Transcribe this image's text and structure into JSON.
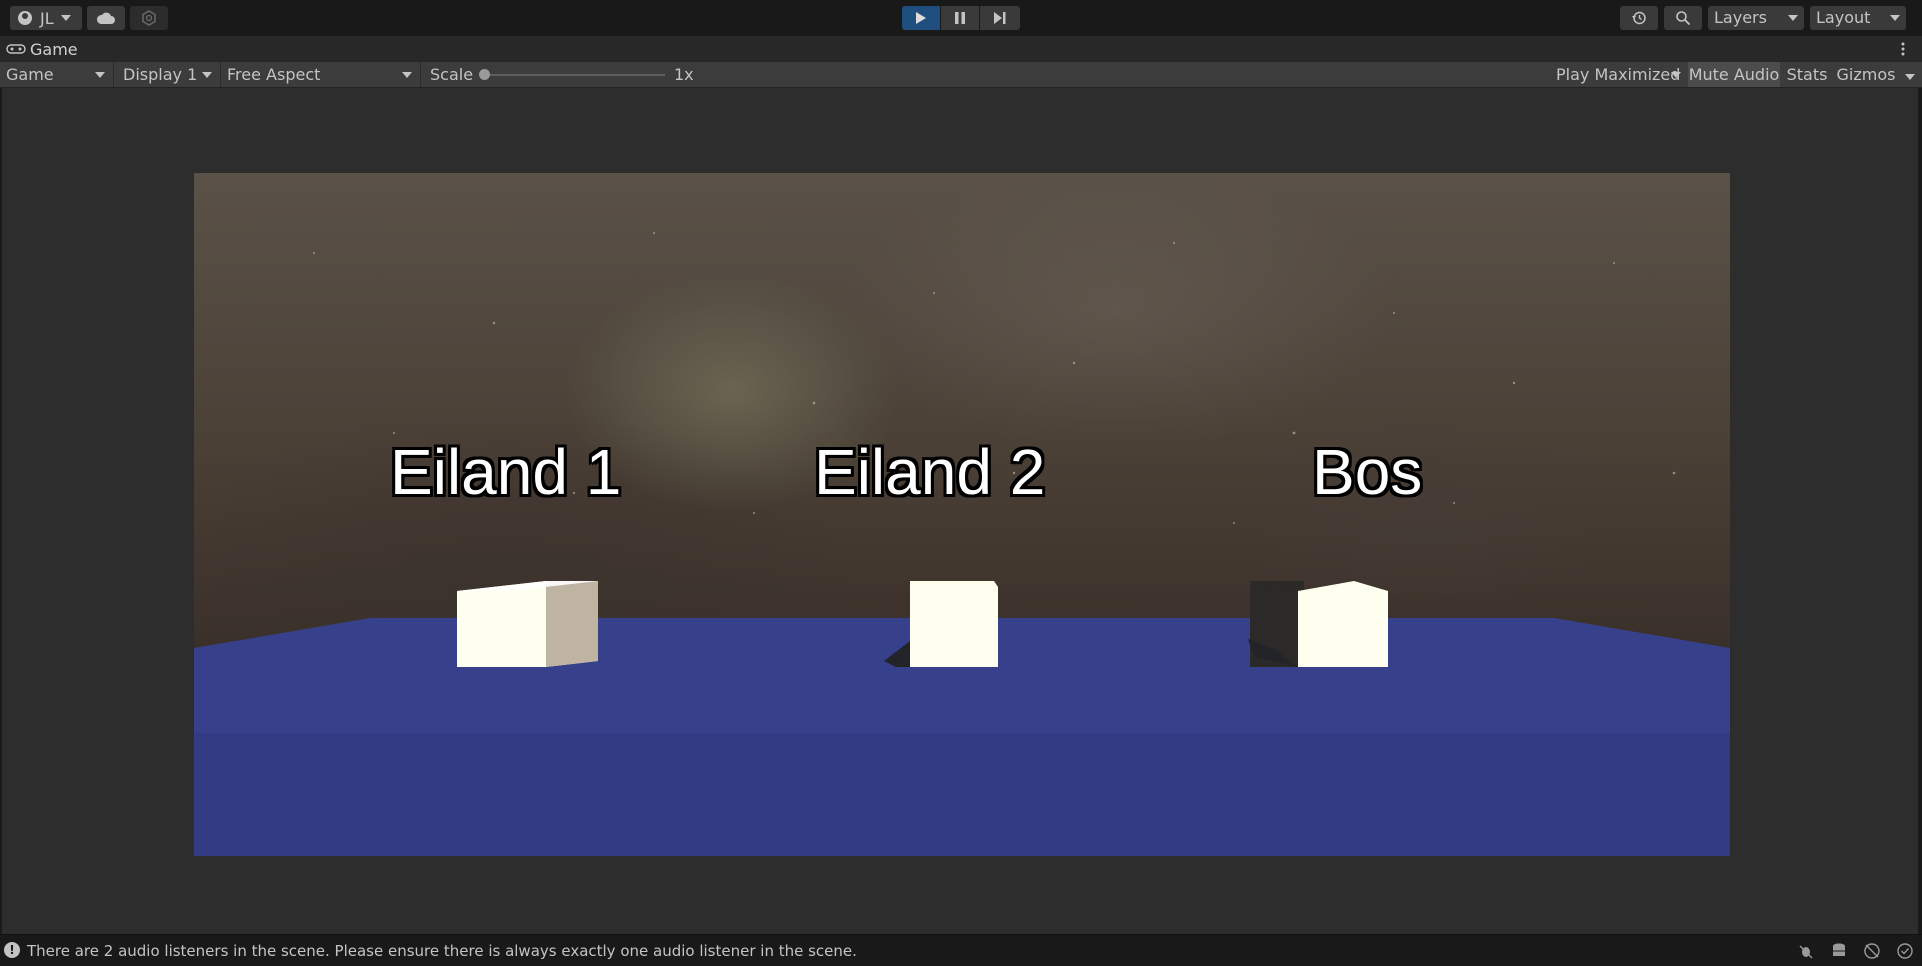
{
  "toolbar": {
    "account_label": "JL",
    "layers_label": "Layers",
    "layout_label": "Layout"
  },
  "tab": {
    "title": "Game"
  },
  "gamebar": {
    "mode": "Game",
    "display": "Display 1",
    "aspect": "Free Aspect",
    "scale_label": "Scale",
    "scale_value": "1x",
    "play_maximized": "Play Maximized",
    "mute_audio": "Mute Audio",
    "stats": "Stats",
    "gizmos": "Gizmos"
  },
  "scene": {
    "labels": [
      "Eiland 1",
      "Eiland 2",
      "Bos"
    ],
    "colors": {
      "floor": "#37408a",
      "cube": "#fffff0",
      "sky": "#4a4036"
    }
  },
  "status": {
    "message": "There are 2 audio listeners in the scene. Please ensure there is always exactly one audio listener in the scene."
  },
  "colors": {
    "play_active": "#1f4f7f",
    "panel": "#3c3c3c",
    "background": "#191919"
  }
}
